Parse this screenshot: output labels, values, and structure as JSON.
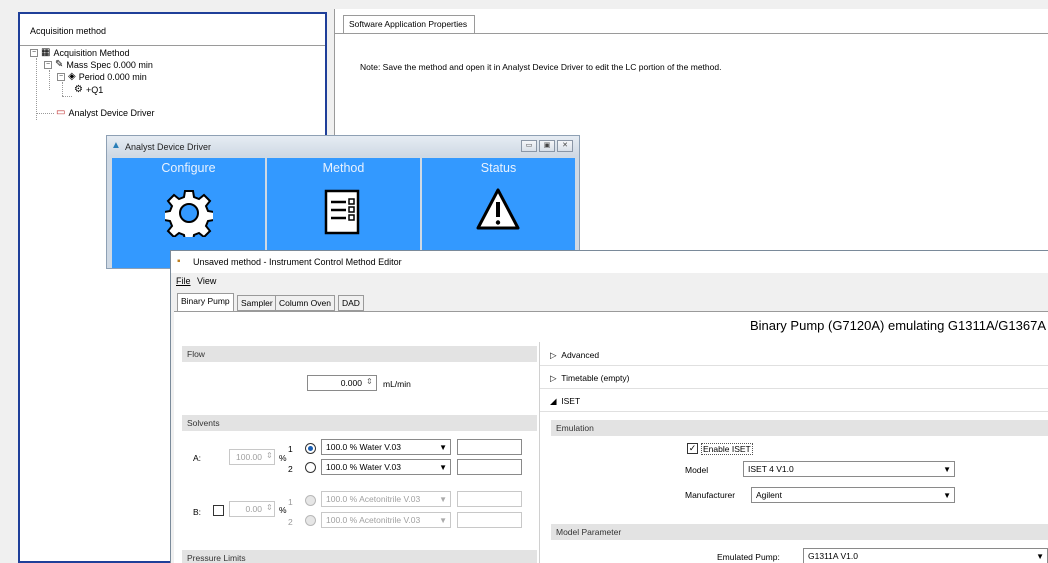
{
  "left_panel": {
    "header": "Acquisition method",
    "tree": {
      "root": "Acquisition Method",
      "mass_spec": "Mass Spec  0.000 min",
      "period": "Period  0.000 min",
      "experiment": "+Q1",
      "device_driver": "Analyst Device Driver"
    }
  },
  "right_panel": {
    "tab": "Software Application Properties",
    "note": "Note: Save the method and open it in Analyst Device Driver to edit the LC portion of the method."
  },
  "device_driver_window": {
    "title": "Analyst Device Driver",
    "tiles": [
      {
        "label": "Configure",
        "icon": "gear-icon"
      },
      {
        "label": "Method",
        "icon": "document-list-icon"
      },
      {
        "label": "Status",
        "icon": "warning-icon"
      }
    ],
    "tile_color": "#3399ff"
  },
  "editor_window": {
    "title": "Unsaved method - Instrument Control Method Editor",
    "menu": {
      "file": "File",
      "view": "View"
    },
    "tabs": [
      "Binary Pump",
      "Sampler",
      "Column Oven",
      "DAD"
    ],
    "module_title": "Binary Pump (G7120A) emulating G1311A/G1367A",
    "flow": {
      "section": "Flow",
      "value": "0.000",
      "unit": "mL/min"
    },
    "solvents": {
      "section": "Solvents",
      "a_label": "A:",
      "a_percent": "100.00",
      "percent_sign": "%",
      "a_ch1_num": "1",
      "a_ch2_num": "2",
      "a_ch1": "100.0 % Water V.03",
      "a_ch2": "100.0 % Water V.03",
      "b_label": "B:",
      "b_percent": "0.00",
      "b_ch1_num": "1",
      "b_ch2_num": "2",
      "b_ch1": "100.0 % Acetonitrile V.03",
      "b_ch2": "100.0 % Acetonitrile V.03"
    },
    "pressure_section": "Pressure Limits",
    "advanced": "Advanced",
    "timetable": "Timetable (empty)",
    "iset": "ISET",
    "emulation": {
      "section": "Emulation",
      "enable_label": "Enable ISET",
      "enable_checked": true,
      "model_label": "Model",
      "model_value": "ISET 4 V1.0",
      "manufacturer_label": "Manufacturer",
      "manufacturer_value": "Agilent"
    },
    "model_parameter": {
      "section": "Model Parameter",
      "emulated_pump_label": "Emulated Pump:",
      "emulated_pump_value": "G1311A V1.0"
    }
  }
}
